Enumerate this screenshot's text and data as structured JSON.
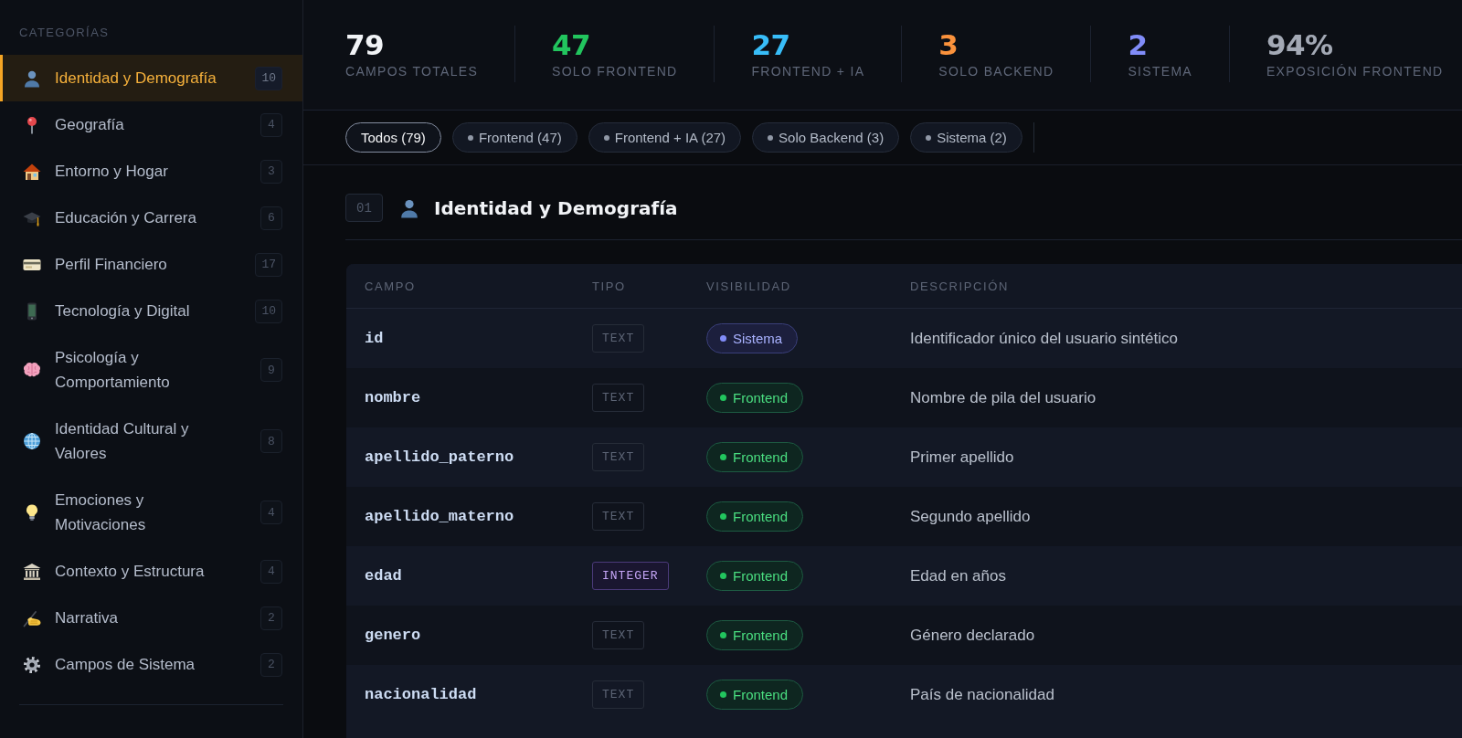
{
  "sidebar": {
    "heading": "CATEGORÍAS",
    "items": [
      {
        "label": "Identidad y Demografía",
        "count": "10",
        "selected": true
      },
      {
        "label": "Geografía",
        "count": "4",
        "selected": false
      },
      {
        "label": "Entorno y Hogar",
        "count": "3",
        "selected": false
      },
      {
        "label": "Educación y Carrera",
        "count": "6",
        "selected": false
      },
      {
        "label": "Perfil Financiero",
        "count": "17",
        "selected": false
      },
      {
        "label": "Tecnología y Digital",
        "count": "10",
        "selected": false
      },
      {
        "label": "Psicología y Comportamiento",
        "count": "9",
        "selected": false
      },
      {
        "label": "Identidad Cultural y Valores",
        "count": "8",
        "selected": false
      },
      {
        "label": "Emociones y Motivaciones",
        "count": "4",
        "selected": false
      },
      {
        "label": "Contexto y Estructura",
        "count": "4",
        "selected": false
      },
      {
        "label": "Narrativa",
        "count": "2",
        "selected": false
      },
      {
        "label": "Campos de Sistema",
        "count": "2",
        "selected": false
      }
    ]
  },
  "stats": [
    {
      "value": "79",
      "label": "CAMPOS TOTALES",
      "color": "#f1f3f6"
    },
    {
      "value": "47",
      "label": "SOLO FRONTEND",
      "color": "#22c55e"
    },
    {
      "value": "27",
      "label": "FRONTEND + IA",
      "color": "#38bdf8"
    },
    {
      "value": "3",
      "label": "SOLO BACKEND",
      "color": "#fb923c"
    },
    {
      "value": "2",
      "label": "SISTEMA",
      "color": "#818cf8"
    },
    {
      "value": "94%",
      "label": "EXPOSICIÓN FRONTEND",
      "color": "#a3a9b5"
    }
  ],
  "filters": [
    {
      "label": "Todos (79)",
      "kind": "all",
      "selected": true
    },
    {
      "label": "Frontend (47)",
      "kind": "visibility",
      "selected": false
    },
    {
      "label": "Frontend + IA (27)",
      "kind": "visibility",
      "selected": false
    },
    {
      "label": "Solo Backend (3)",
      "kind": "visibility",
      "selected": false
    },
    {
      "label": "Sistema (2)",
      "kind": "visibility",
      "selected": false
    }
  ],
  "section": {
    "number": "01",
    "title": "Identidad y Demografía"
  },
  "table": {
    "columns": [
      "CAMPO",
      "TIPO",
      "VISIBILIDAD",
      "DESCRIPCIÓN"
    ],
    "rows": [
      {
        "field": "id",
        "type": {
          "label": "TEXT",
          "kind": "text"
        },
        "visibility": {
          "label": "Sistema",
          "kind": "system"
        },
        "description": "Identificador único del usuario sintético"
      },
      {
        "field": "nombre",
        "type": {
          "label": "TEXT",
          "kind": "text"
        },
        "visibility": {
          "label": "Frontend",
          "kind": "frontend"
        },
        "description": "Nombre de pila del usuario"
      },
      {
        "field": "apellido_paterno",
        "type": {
          "label": "TEXT",
          "kind": "text"
        },
        "visibility": {
          "label": "Frontend",
          "kind": "frontend"
        },
        "description": "Primer apellido"
      },
      {
        "field": "apellido_materno",
        "type": {
          "label": "TEXT",
          "kind": "text"
        },
        "visibility": {
          "label": "Frontend",
          "kind": "frontend"
        },
        "description": "Segundo apellido"
      },
      {
        "field": "edad",
        "type": {
          "label": "INTEGER",
          "kind": "integer"
        },
        "visibility": {
          "label": "Frontend",
          "kind": "frontend"
        },
        "description": "Edad en años"
      },
      {
        "field": "genero",
        "type": {
          "label": "TEXT",
          "kind": "text"
        },
        "visibility": {
          "label": "Frontend",
          "kind": "frontend"
        },
        "description": "Género declarado"
      },
      {
        "field": "nacionalidad",
        "type": {
          "label": "TEXT",
          "kind": "text"
        },
        "visibility": {
          "label": "Frontend",
          "kind": "frontend"
        },
        "description": "País de nacionalidad"
      }
    ]
  }
}
